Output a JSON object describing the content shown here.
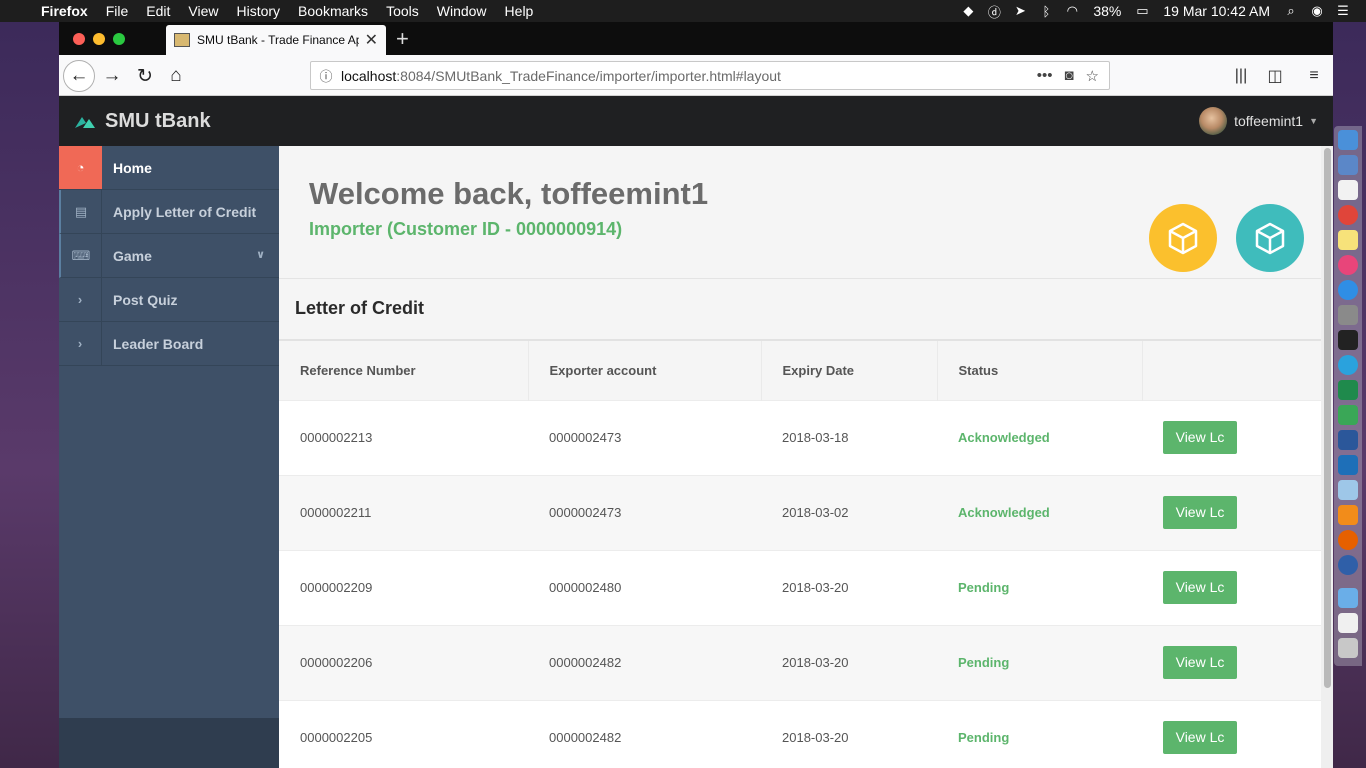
{
  "menubar": {
    "app_name": "Firefox",
    "menus": [
      "File",
      "Edit",
      "View",
      "History",
      "Bookmarks",
      "Tools",
      "Window",
      "Help"
    ],
    "battery": "38%",
    "clock": "19 Mar  10:42 AM"
  },
  "browser": {
    "tab_title": "SMU tBank - Trade Finance App",
    "url_host": "localhost",
    "url_path": ":8084/SMUtBank_TradeFinance/importer/importer.html#layout"
  },
  "app": {
    "brand": "SMU tBank",
    "username": "toffeemint1",
    "sidebar": {
      "items": [
        {
          "label": "Home",
          "icon": "dashboard-icon"
        },
        {
          "label": "Apply Letter of Credit",
          "icon": "document-icon"
        },
        {
          "label": "Game",
          "icon": "gamepad-icon"
        },
        {
          "label": "Post Quiz",
          "icon": "chevron-right-icon"
        },
        {
          "label": "Leader Board",
          "icon": "chevron-right-icon"
        }
      ]
    },
    "welcome": {
      "title": "Welcome back, toffeemint1",
      "subtitle": "Importer (Customer ID - 0000000914)"
    },
    "lc": {
      "title": "Letter of Credit",
      "columns": [
        "Reference Number",
        "Exporter account",
        "Expiry Date",
        "Status",
        ""
      ],
      "rows": [
        {
          "ref": "0000002213",
          "exporter": "0000002473",
          "expiry": "2018-03-18",
          "status": "Acknowledged",
          "action": "View Lc"
        },
        {
          "ref": "0000002211",
          "exporter": "0000002473",
          "expiry": "2018-03-02",
          "status": "Acknowledged",
          "action": "View Lc"
        },
        {
          "ref": "0000002209",
          "exporter": "0000002480",
          "expiry": "2018-03-20",
          "status": "Pending",
          "action": "View Lc"
        },
        {
          "ref": "0000002206",
          "exporter": "0000002482",
          "expiry": "2018-03-20",
          "status": "Pending",
          "action": "View Lc"
        },
        {
          "ref": "0000002205",
          "exporter": "0000002482",
          "expiry": "2018-03-20",
          "status": "Pending",
          "action": "View Lc"
        }
      ]
    },
    "colors": {
      "accent_green": "#5cb56c",
      "active_red": "#f06956",
      "cube_yellow": "#fbc02d",
      "cube_teal": "#3fbcbc",
      "sidebar": "#3e5067"
    }
  }
}
